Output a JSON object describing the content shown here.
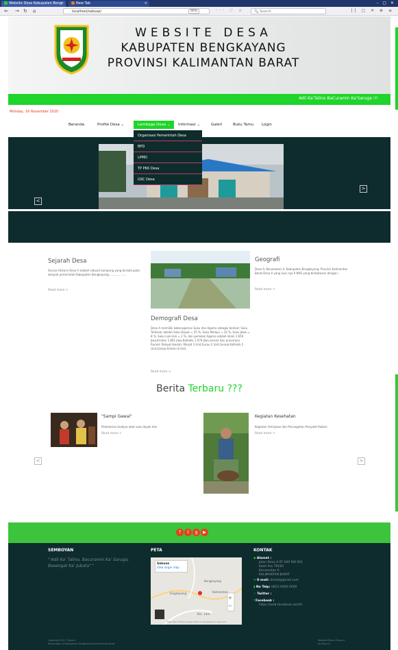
{
  "browser": {
    "tabs": [
      {
        "title": "Website Desa Kabupaten Beng"
      },
      {
        "title": "New Tab"
      }
    ],
    "url": "localhost/sekuas/",
    "zoom": "90%",
    "search_placeholder": "Search"
  },
  "header": {
    "line1": "WEBSITE DESA",
    "line2": "KABUPATEN BENGKAYANG",
    "line3": "PROVINSI KALIMANTAN BARAT",
    "motto": "Adil Ka'Talino BaCuramin Ka'Saruga !!!"
  },
  "date": "Monday, 16 November 2020",
  "menu": {
    "items": [
      {
        "label": "Beranda"
      },
      {
        "label": "Profile Desa"
      },
      {
        "label": "Lembaga Desa"
      },
      {
        "label": "Informasi"
      },
      {
        "label": "Galeri"
      },
      {
        "label": "Buku Tamu"
      },
      {
        "label": "Login"
      }
    ],
    "dropdown": [
      {
        "label": "Organisasi Pemerintah Desa"
      },
      {
        "label": "BPD"
      },
      {
        "label": "LPMD"
      },
      {
        "label": "TP PKK Desa"
      },
      {
        "label": "GSC Desa"
      }
    ]
  },
  "slider": {
    "prev": "<",
    "next": ">"
  },
  "profile": {
    "sejarah": {
      "title": "Sejarah Desa",
      "text": "Secara Historis Desa A adalah sebuah kampung yang berada pada wilayah pemerintah Kabupaten Bengkayang, ..................",
      "more": "Read more >"
    },
    "demografi": {
      "title": "Demografi Desa",
      "text": "Desa A memiliki keberagaman Suku dan Agama sebagai berikut; Suku Terbesar adalah Suku Dayak = 55 %, Suku Melayu = 35 %, Suku Jawa = 8 %, Suku Lain-lain = 2 %, dan pemeluk Agama adalah Islam 1.659 Jiwa,Kristen 1.861 Jiwa,Katholik 1.079 Jiwa,sarana dan prasarana Rumah Tempat Ibadah; Masjid 3 Unit,Surau 2 Unit,Gereja Katholik 2 Unit,Gereja Kristen 8 Unit,",
      "more": "Read more >"
    },
    "geografi": {
      "title": "Geografi",
      "text": "Desa A, Kecamatan A, Kabupaten Bengkayang, Provinsi Kalimantan Barat.Desa A yang luas nya 0 KM2 yang berbatasan dengan :",
      "more": "Read more >"
    }
  },
  "berita": {
    "title_a": "Berita ",
    "title_b": "Terbaru ???",
    "items": [
      {
        "title": "\"Sampi Gawai\"",
        "text": "Pelestarian budaya adat suku dayak dan",
        "more": "Read more >"
      },
      {
        "title": "Kegiatan Kesehatan",
        "text": "Kegiatan Antisipasi dan Pencegahan Penyakit Rabies",
        "more": "Read more >"
      }
    ],
    "prev": "<",
    "next": ">"
  },
  "social": {
    "icons": [
      "facebook-icon",
      "twitter-icon",
      "google-plus-icon",
      "youtube-icon"
    ],
    "color": "#e8401b"
  },
  "footer": {
    "semboyan_title": "SEMBOYAN",
    "semboyan_text": "\"'Adil Ka' Talino, Bacuramin Ka' Saruga, Basengat Ka' Jubata\" \"",
    "peta_title": "PETA",
    "map_place": "Sekuas",
    "map_link": "View larger map",
    "map_labels": [
      "Bengkayang",
      "Kalimantan",
      "Singkawang",
      "Kec. Lara"
    ],
    "map_footer": "Map data ©2020 Google   Terms of Use   Report a map error",
    "kontak_title": "KONTAK",
    "alamat_label": "Alamat :",
    "alamat_lines": [
      "Jalan Desa A RT 000 RW 001",
      "Kode Pos 79183",
      "Kecamatan A",
      "KALIMANTAN BARAT"
    ],
    "email_label": "E-mail:",
    "email_value": "desaA@gmail.com",
    "telp_label": "No Telp:",
    "telp_value": "0823-0000-0000",
    "twitter_label": "Twitter :",
    "facebook_label": "Facebook :",
    "facebook_value": "https://web.facebook.com/A",
    "copyright_1": "Copyright 2017 Desa A",
    "copyright_2": "Kecamatan A Kabupaten Bengkayang Kalimantan Barat",
    "right_1": "Website Resmi Desa A",
    "right_2": "by Desa A"
  },
  "colors": {
    "accent": "#1fd42b",
    "dark": "#0e2b2d",
    "date": "#e53a1e"
  }
}
